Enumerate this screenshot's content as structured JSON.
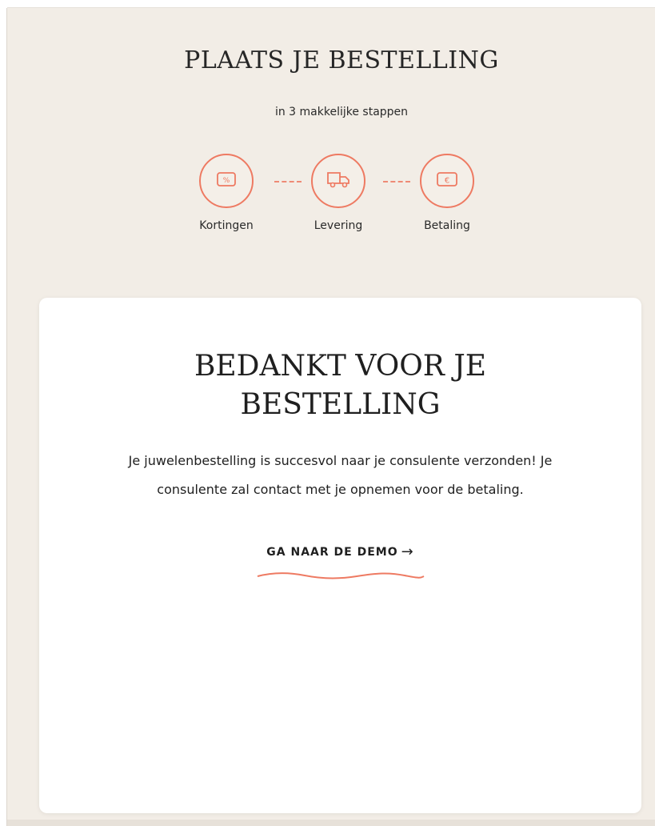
{
  "header": {
    "title": "PLAATS JE BESTELLING",
    "subtitle": "in 3 makkelijke stappen"
  },
  "steps": [
    {
      "label": "Kortingen",
      "icon": "percent-tag-icon"
    },
    {
      "label": "Levering",
      "icon": "delivery-truck-icon"
    },
    {
      "label": "Betaling",
      "icon": "euro-payment-icon"
    }
  ],
  "confirmation": {
    "title_line1": "BEDANKT VOOR JE",
    "title_line2": "BESTELLING",
    "message_line1": "Je juwelenbestelling is succesvol naar je consulente verzonden! Je",
    "message_line2": "consulente zal contact met je opnemen voor de betaling.",
    "link_label": "GA NAAR DE DEMO",
    "link_arrow": "→"
  },
  "colors": {
    "accent": "#ee7a62",
    "page_background": "#f2ede6",
    "card_background": "#ffffff",
    "text": "#1f1f1f"
  }
}
